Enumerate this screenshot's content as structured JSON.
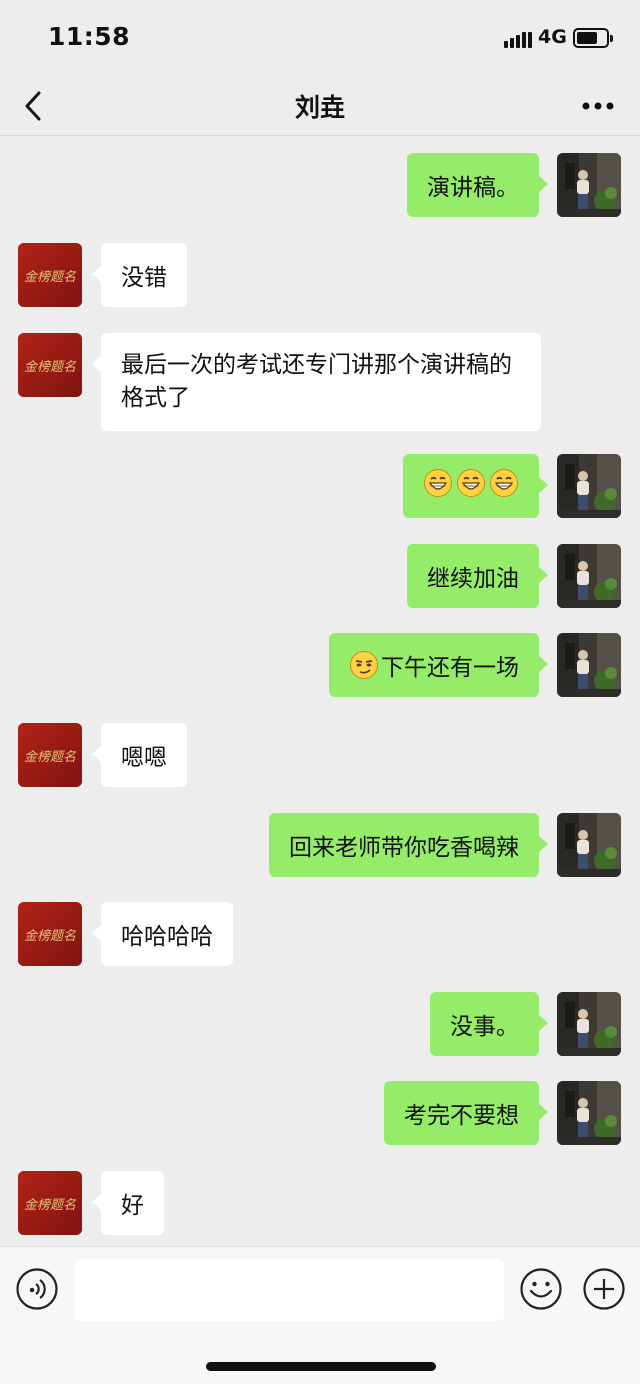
{
  "status_bar": {
    "time": "11:58",
    "network": "4G",
    "icons": [
      "signal-icon",
      "battery-icon"
    ]
  },
  "nav": {
    "title": "刘垚",
    "back_icon": "chevron-left-icon",
    "more_icon": "more-dots-icon"
  },
  "contact_avatar": {
    "text": "金榜题名",
    "color": "#9c1b14",
    "text_color": "#e8c27a"
  },
  "messages": [
    {
      "side": "right",
      "text": "演讲稿。"
    },
    {
      "side": "left",
      "text": "没错"
    },
    {
      "side": "left",
      "text": "最后一次的考试还专门讲那个演讲稿的格式了"
    },
    {
      "side": "right",
      "text": "",
      "emoji": [
        "grin-emoji",
        "grin-emoji",
        "grin-emoji"
      ]
    },
    {
      "side": "right",
      "text": "继续加油"
    },
    {
      "side": "right",
      "text": "下午还有一场",
      "emoji": [
        "smirk-emoji"
      ]
    },
    {
      "side": "left",
      "text": "嗯嗯"
    },
    {
      "side": "right",
      "text": "回来老师带你吃香喝辣"
    },
    {
      "side": "left",
      "text": "哈哈哈哈"
    },
    {
      "side": "right",
      "text": "没事。"
    },
    {
      "side": "right",
      "text": "考完不要想"
    },
    {
      "side": "left",
      "text": "好"
    }
  ],
  "input_bar": {
    "placeholder": "",
    "icons": [
      "voice-icon",
      "emoji-icon",
      "plus-icon"
    ]
  },
  "colors": {
    "background": "#ededed",
    "my_bubble": "#95ec69",
    "their_bubble": "#ffffff"
  }
}
